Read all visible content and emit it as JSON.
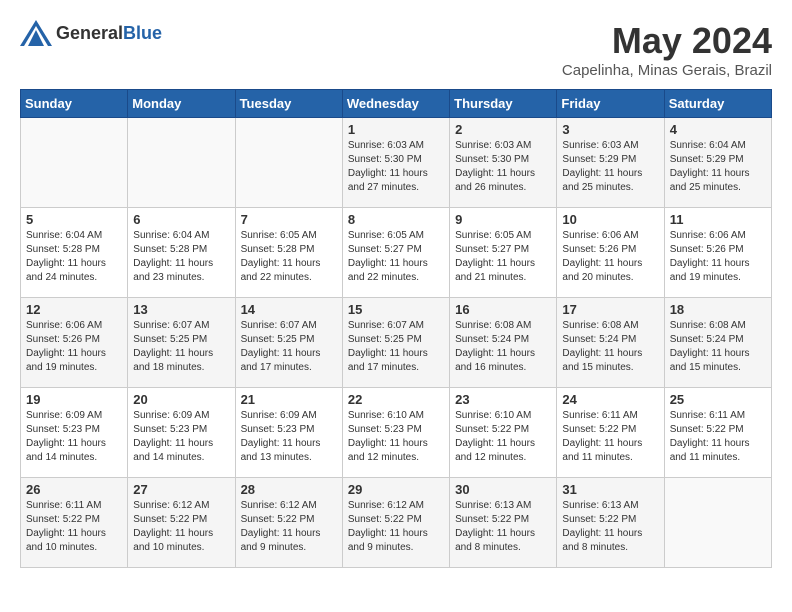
{
  "header": {
    "logo_general": "General",
    "logo_blue": "Blue",
    "title": "May 2024",
    "location": "Capelinha, Minas Gerais, Brazil"
  },
  "days_of_week": [
    "Sunday",
    "Monday",
    "Tuesday",
    "Wednesday",
    "Thursday",
    "Friday",
    "Saturday"
  ],
  "weeks": [
    [
      {
        "day": "",
        "content": ""
      },
      {
        "day": "",
        "content": ""
      },
      {
        "day": "",
        "content": ""
      },
      {
        "day": "1",
        "content": "Sunrise: 6:03 AM\nSunset: 5:30 PM\nDaylight: 11 hours and 27 minutes."
      },
      {
        "day": "2",
        "content": "Sunrise: 6:03 AM\nSunset: 5:30 PM\nDaylight: 11 hours and 26 minutes."
      },
      {
        "day": "3",
        "content": "Sunrise: 6:03 AM\nSunset: 5:29 PM\nDaylight: 11 hours and 25 minutes."
      },
      {
        "day": "4",
        "content": "Sunrise: 6:04 AM\nSunset: 5:29 PM\nDaylight: 11 hours and 25 minutes."
      }
    ],
    [
      {
        "day": "5",
        "content": "Sunrise: 6:04 AM\nSunset: 5:28 PM\nDaylight: 11 hours and 24 minutes."
      },
      {
        "day": "6",
        "content": "Sunrise: 6:04 AM\nSunset: 5:28 PM\nDaylight: 11 hours and 23 minutes."
      },
      {
        "day": "7",
        "content": "Sunrise: 6:05 AM\nSunset: 5:28 PM\nDaylight: 11 hours and 22 minutes."
      },
      {
        "day": "8",
        "content": "Sunrise: 6:05 AM\nSunset: 5:27 PM\nDaylight: 11 hours and 22 minutes."
      },
      {
        "day": "9",
        "content": "Sunrise: 6:05 AM\nSunset: 5:27 PM\nDaylight: 11 hours and 21 minutes."
      },
      {
        "day": "10",
        "content": "Sunrise: 6:06 AM\nSunset: 5:26 PM\nDaylight: 11 hours and 20 minutes."
      },
      {
        "day": "11",
        "content": "Sunrise: 6:06 AM\nSunset: 5:26 PM\nDaylight: 11 hours and 19 minutes."
      }
    ],
    [
      {
        "day": "12",
        "content": "Sunrise: 6:06 AM\nSunset: 5:26 PM\nDaylight: 11 hours and 19 minutes."
      },
      {
        "day": "13",
        "content": "Sunrise: 6:07 AM\nSunset: 5:25 PM\nDaylight: 11 hours and 18 minutes."
      },
      {
        "day": "14",
        "content": "Sunrise: 6:07 AM\nSunset: 5:25 PM\nDaylight: 11 hours and 17 minutes."
      },
      {
        "day": "15",
        "content": "Sunrise: 6:07 AM\nSunset: 5:25 PM\nDaylight: 11 hours and 17 minutes."
      },
      {
        "day": "16",
        "content": "Sunrise: 6:08 AM\nSunset: 5:24 PM\nDaylight: 11 hours and 16 minutes."
      },
      {
        "day": "17",
        "content": "Sunrise: 6:08 AM\nSunset: 5:24 PM\nDaylight: 11 hours and 15 minutes."
      },
      {
        "day": "18",
        "content": "Sunrise: 6:08 AM\nSunset: 5:24 PM\nDaylight: 11 hours and 15 minutes."
      }
    ],
    [
      {
        "day": "19",
        "content": "Sunrise: 6:09 AM\nSunset: 5:23 PM\nDaylight: 11 hours and 14 minutes."
      },
      {
        "day": "20",
        "content": "Sunrise: 6:09 AM\nSunset: 5:23 PM\nDaylight: 11 hours and 14 minutes."
      },
      {
        "day": "21",
        "content": "Sunrise: 6:09 AM\nSunset: 5:23 PM\nDaylight: 11 hours and 13 minutes."
      },
      {
        "day": "22",
        "content": "Sunrise: 6:10 AM\nSunset: 5:23 PM\nDaylight: 11 hours and 12 minutes."
      },
      {
        "day": "23",
        "content": "Sunrise: 6:10 AM\nSunset: 5:22 PM\nDaylight: 11 hours and 12 minutes."
      },
      {
        "day": "24",
        "content": "Sunrise: 6:11 AM\nSunset: 5:22 PM\nDaylight: 11 hours and 11 minutes."
      },
      {
        "day": "25",
        "content": "Sunrise: 6:11 AM\nSunset: 5:22 PM\nDaylight: 11 hours and 11 minutes."
      }
    ],
    [
      {
        "day": "26",
        "content": "Sunrise: 6:11 AM\nSunset: 5:22 PM\nDaylight: 11 hours and 10 minutes."
      },
      {
        "day": "27",
        "content": "Sunrise: 6:12 AM\nSunset: 5:22 PM\nDaylight: 11 hours and 10 minutes."
      },
      {
        "day": "28",
        "content": "Sunrise: 6:12 AM\nSunset: 5:22 PM\nDaylight: 11 hours and 9 minutes."
      },
      {
        "day": "29",
        "content": "Sunrise: 6:12 AM\nSunset: 5:22 PM\nDaylight: 11 hours and 9 minutes."
      },
      {
        "day": "30",
        "content": "Sunrise: 6:13 AM\nSunset: 5:22 PM\nDaylight: 11 hours and 8 minutes."
      },
      {
        "day": "31",
        "content": "Sunrise: 6:13 AM\nSunset: 5:22 PM\nDaylight: 11 hours and 8 minutes."
      },
      {
        "day": "",
        "content": ""
      }
    ]
  ]
}
